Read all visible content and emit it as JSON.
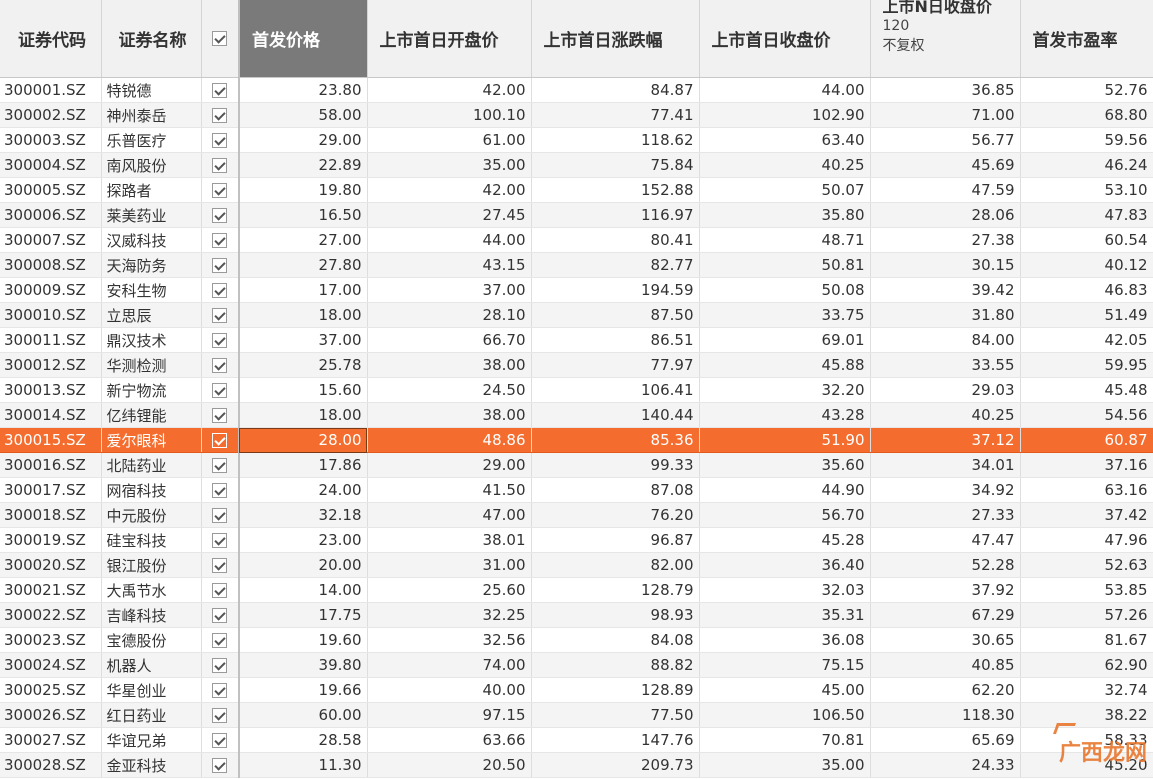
{
  "columns": {
    "code": "证券代码",
    "name": "证券名称",
    "ipo_price": "首发价格",
    "first_open": "上市首日开盘价",
    "first_change": "上市首日涨跌幅",
    "first_close": "上市首日收盘价",
    "nday_close_title": "上市N日收盘价",
    "nday_close_n": "120",
    "nday_close_adj": "不复权",
    "ipo_pe": "首发市盈率"
  },
  "selected_row": "300015.SZ",
  "colors": {
    "selected": "#f56d2e",
    "sorted_header": "#7a7a7a"
  },
  "rows": [
    {
      "code": "300001.SZ",
      "name": "特锐德",
      "price": "23.80",
      "open": "42.00",
      "change": "84.87",
      "close": "44.00",
      "nclose": "36.85",
      "pe": "52.76"
    },
    {
      "code": "300002.SZ",
      "name": "神州泰岳",
      "price": "58.00",
      "open": "100.10",
      "change": "77.41",
      "close": "102.90",
      "nclose": "71.00",
      "pe": "68.80"
    },
    {
      "code": "300003.SZ",
      "name": "乐普医疗",
      "price": "29.00",
      "open": "61.00",
      "change": "118.62",
      "close": "63.40",
      "nclose": "56.77",
      "pe": "59.56"
    },
    {
      "code": "300004.SZ",
      "name": "南风股份",
      "price": "22.89",
      "open": "35.00",
      "change": "75.84",
      "close": "40.25",
      "nclose": "45.69",
      "pe": "46.24"
    },
    {
      "code": "300005.SZ",
      "name": "探路者",
      "price": "19.80",
      "open": "42.00",
      "change": "152.88",
      "close": "50.07",
      "nclose": "47.59",
      "pe": "53.10"
    },
    {
      "code": "300006.SZ",
      "name": "莱美药业",
      "price": "16.50",
      "open": "27.45",
      "change": "116.97",
      "close": "35.80",
      "nclose": "28.06",
      "pe": "47.83"
    },
    {
      "code": "300007.SZ",
      "name": "汉威科技",
      "price": "27.00",
      "open": "44.00",
      "change": "80.41",
      "close": "48.71",
      "nclose": "27.38",
      "pe": "60.54"
    },
    {
      "code": "300008.SZ",
      "name": "天海防务",
      "price": "27.80",
      "open": "43.15",
      "change": "82.77",
      "close": "50.81",
      "nclose": "30.15",
      "pe": "40.12"
    },
    {
      "code": "300009.SZ",
      "name": "安科生物",
      "price": "17.00",
      "open": "37.00",
      "change": "194.59",
      "close": "50.08",
      "nclose": "39.42",
      "pe": "46.83"
    },
    {
      "code": "300010.SZ",
      "name": "立思辰",
      "price": "18.00",
      "open": "28.10",
      "change": "87.50",
      "close": "33.75",
      "nclose": "31.80",
      "pe": "51.49"
    },
    {
      "code": "300011.SZ",
      "name": "鼎汉技术",
      "price": "37.00",
      "open": "66.70",
      "change": "86.51",
      "close": "69.01",
      "nclose": "84.00",
      "pe": "42.05"
    },
    {
      "code": "300012.SZ",
      "name": "华测检测",
      "price": "25.78",
      "open": "38.00",
      "change": "77.97",
      "close": "45.88",
      "nclose": "33.55",
      "pe": "59.95"
    },
    {
      "code": "300013.SZ",
      "name": "新宁物流",
      "price": "15.60",
      "open": "24.50",
      "change": "106.41",
      "close": "32.20",
      "nclose": "29.03",
      "pe": "45.48"
    },
    {
      "code": "300014.SZ",
      "name": "亿纬锂能",
      "price": "18.00",
      "open": "38.00",
      "change": "140.44",
      "close": "43.28",
      "nclose": "40.25",
      "pe": "54.56"
    },
    {
      "code": "300015.SZ",
      "name": "爱尔眼科",
      "price": "28.00",
      "open": "48.86",
      "change": "85.36",
      "close": "51.90",
      "nclose": "37.12",
      "pe": "60.87"
    },
    {
      "code": "300016.SZ",
      "name": "北陆药业",
      "price": "17.86",
      "open": "29.00",
      "change": "99.33",
      "close": "35.60",
      "nclose": "34.01",
      "pe": "37.16"
    },
    {
      "code": "300017.SZ",
      "name": "网宿科技",
      "price": "24.00",
      "open": "41.50",
      "change": "87.08",
      "close": "44.90",
      "nclose": "34.92",
      "pe": "63.16"
    },
    {
      "code": "300018.SZ",
      "name": "中元股份",
      "price": "32.18",
      "open": "47.00",
      "change": "76.20",
      "close": "56.70",
      "nclose": "27.33",
      "pe": "37.42"
    },
    {
      "code": "300019.SZ",
      "name": "硅宝科技",
      "price": "23.00",
      "open": "38.01",
      "change": "96.87",
      "close": "45.28",
      "nclose": "47.47",
      "pe": "47.96"
    },
    {
      "code": "300020.SZ",
      "name": "银江股份",
      "price": "20.00",
      "open": "31.00",
      "change": "82.00",
      "close": "36.40",
      "nclose": "52.28",
      "pe": "52.63"
    },
    {
      "code": "300021.SZ",
      "name": "大禹节水",
      "price": "14.00",
      "open": "25.60",
      "change": "128.79",
      "close": "32.03",
      "nclose": "37.92",
      "pe": "53.85"
    },
    {
      "code": "300022.SZ",
      "name": "吉峰科技",
      "price": "17.75",
      "open": "32.25",
      "change": "98.93",
      "close": "35.31",
      "nclose": "67.29",
      "pe": "57.26"
    },
    {
      "code": "300023.SZ",
      "name": "宝德股份",
      "price": "19.60",
      "open": "32.56",
      "change": "84.08",
      "close": "36.08",
      "nclose": "30.65",
      "pe": "81.67"
    },
    {
      "code": "300024.SZ",
      "name": "机器人",
      "price": "39.80",
      "open": "74.00",
      "change": "88.82",
      "close": "75.15",
      "nclose": "40.85",
      "pe": "62.90"
    },
    {
      "code": "300025.SZ",
      "name": "华星创业",
      "price": "19.66",
      "open": "40.00",
      "change": "128.89",
      "close": "45.00",
      "nclose": "62.20",
      "pe": "32.74"
    },
    {
      "code": "300026.SZ",
      "name": "红日药业",
      "price": "60.00",
      "open": "97.15",
      "change": "77.50",
      "close": "106.50",
      "nclose": "118.30",
      "pe": "38.22"
    },
    {
      "code": "300027.SZ",
      "name": "华谊兄弟",
      "price": "28.58",
      "open": "63.66",
      "change": "147.76",
      "close": "70.81",
      "nclose": "65.69",
      "pe": "58.33"
    },
    {
      "code": "300028.SZ",
      "name": "金亚科技",
      "price": "11.30",
      "open": "20.50",
      "change": "209.73",
      "close": "35.00",
      "nclose": "24.33",
      "pe": "45.20"
    }
  ],
  "watermark": "广西龙网"
}
